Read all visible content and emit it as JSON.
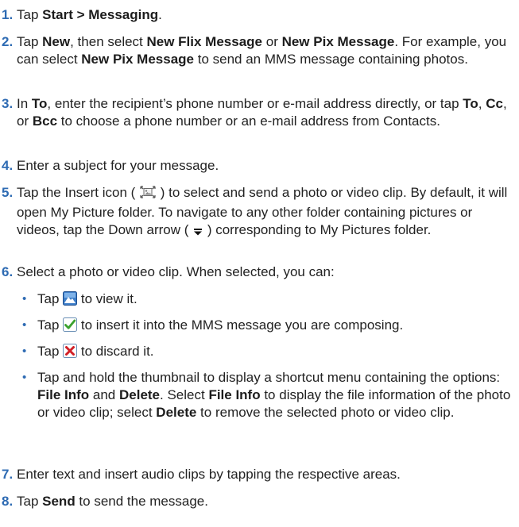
{
  "steps": [
    {
      "num": "1.",
      "parts": [
        "Tap ",
        "Start > Messaging",
        "."
      ]
    },
    {
      "num": "2.",
      "parts": [
        "Tap ",
        "New",
        ", then select ",
        "New Flix Message",
        " or ",
        "New Pix Message",
        ". For example, you can select ",
        "New Pix Message",
        " to send an MMS message containing photos."
      ]
    },
    {
      "num": "3.",
      "parts": [
        "In ",
        "To",
        ", enter the recipient’s phone number or e-mail address directly, or tap ",
        "To",
        ", ",
        "Cc",
        ", or ",
        "Bcc",
        " to choose a phone number or an e-mail address from Contacts."
      ]
    },
    {
      "num": "4.",
      "parts": [
        "Enter a subject for your message."
      ]
    },
    {
      "num": "5.",
      "parts": [
        "Tap the Insert icon ( ",
        " ) to select and send a photo or video clip. By default, it will open My Picture folder. To navigate to any other folder containing pictures or videos, tap the Down arrow ( ",
        " ) corresponding to My Pictures folder."
      ]
    },
    {
      "num": "6.",
      "parts": [
        "Select a photo or video clip. When selected, you can:"
      ]
    },
    {
      "num": "7.",
      "parts": [
        "Enter text and insert audio clips by tapping the respective areas."
      ]
    },
    {
      "num": "8.",
      "parts": [
        "Tap ",
        "Send",
        " to send the message."
      ]
    }
  ],
  "bullets": [
    {
      "dot": "•",
      "parts": [
        "Tap ",
        " to view it."
      ]
    },
    {
      "dot": "•",
      "parts": [
        "Tap ",
        " to insert it into the MMS message you are composing."
      ]
    },
    {
      "dot": "•",
      "parts": [
        "Tap ",
        " to discard it."
      ]
    },
    {
      "dot": "•",
      "parts": [
        "Tap and hold the thumbnail to display a shortcut menu containing the options: ",
        "File Info",
        " and ",
        "Delete",
        ". Select ",
        "File Info",
        " to display the file information of the photo or video clip; select ",
        "Delete",
        " to remove the selected photo or video clip."
      ]
    }
  ],
  "icons": {
    "insert": "insert-media-icon",
    "down_arrow": "down-arrow-icon",
    "view": "view-picture-icon",
    "insert_ok": "checkmark-icon",
    "discard": "discard-x-icon"
  },
  "colors": {
    "number_accent": "#2e6bb3",
    "text": "#222222",
    "check_green": "#3aa12f",
    "discard_red": "#d11f26"
  }
}
